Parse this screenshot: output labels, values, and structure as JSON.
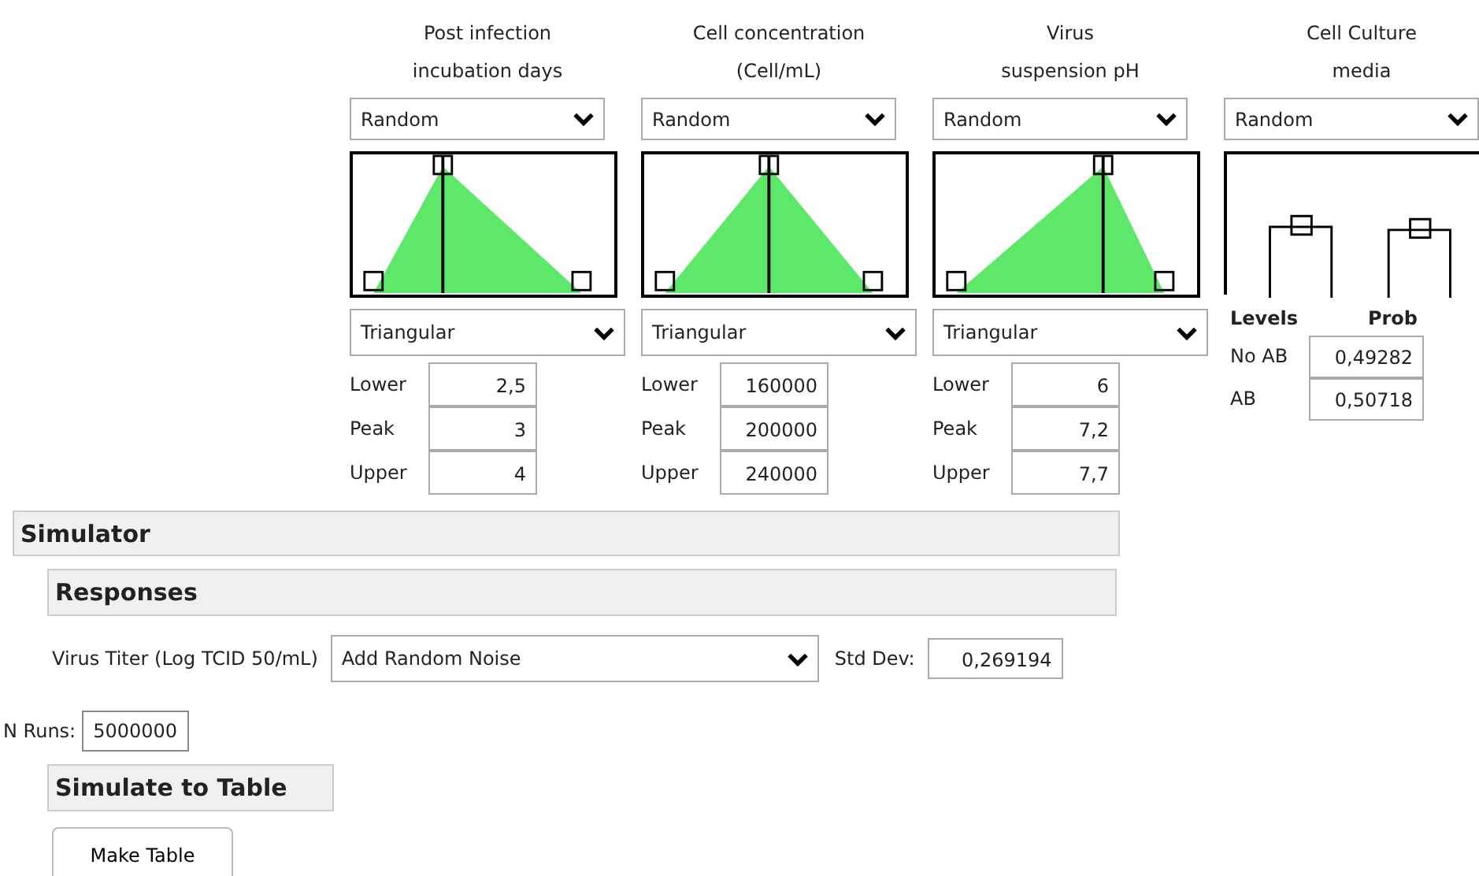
{
  "factors": [
    {
      "kind": "continuous",
      "title_lines": [
        "Post infection",
        "incubation days"
      ],
      "mode": "Random",
      "distribution": "Triangular",
      "params": [
        {
          "label": "Lower",
          "value": "2,5"
        },
        {
          "label": "Peak",
          "value": "3"
        },
        {
          "label": "Upper",
          "value": "4"
        }
      ]
    },
    {
      "kind": "continuous",
      "title_lines": [
        "Cell concentration",
        "(Cell/mL)"
      ],
      "mode": "Random",
      "distribution": "Triangular",
      "params": [
        {
          "label": "Lower",
          "value": "160000"
        },
        {
          "label": "Peak",
          "value": "200000"
        },
        {
          "label": "Upper",
          "value": "240000"
        }
      ]
    },
    {
      "kind": "continuous",
      "title_lines": [
        "Virus",
        "suspension pH"
      ],
      "mode": "Random",
      "distribution": "Triangular",
      "params": [
        {
          "label": "Lower",
          "value": "6"
        },
        {
          "label": "Peak",
          "value": "7,2"
        },
        {
          "label": "Upper",
          "value": "7,7"
        }
      ]
    },
    {
      "kind": "categorical",
      "title_lines": [
        "Cell Culture",
        "media"
      ],
      "mode": "Random",
      "columns": [
        "Levels",
        "Prob"
      ],
      "levels": [
        {
          "level": "No AB",
          "prob": "0,49282"
        },
        {
          "level": "AB",
          "prob": "0,50718"
        }
      ]
    }
  ],
  "simulator": {
    "title": "Simulator",
    "responses_title": "Responses",
    "response": {
      "label": "Virus  Titer (Log TCID 50/mL)",
      "noise": "Add Random Noise",
      "std_label": "Std Dev:",
      "std_value": "0,269194"
    },
    "runs_label": "N Runs:",
    "runs_value": "5000000",
    "table_title": "Simulate to Table",
    "make_button": "Make Table"
  }
}
